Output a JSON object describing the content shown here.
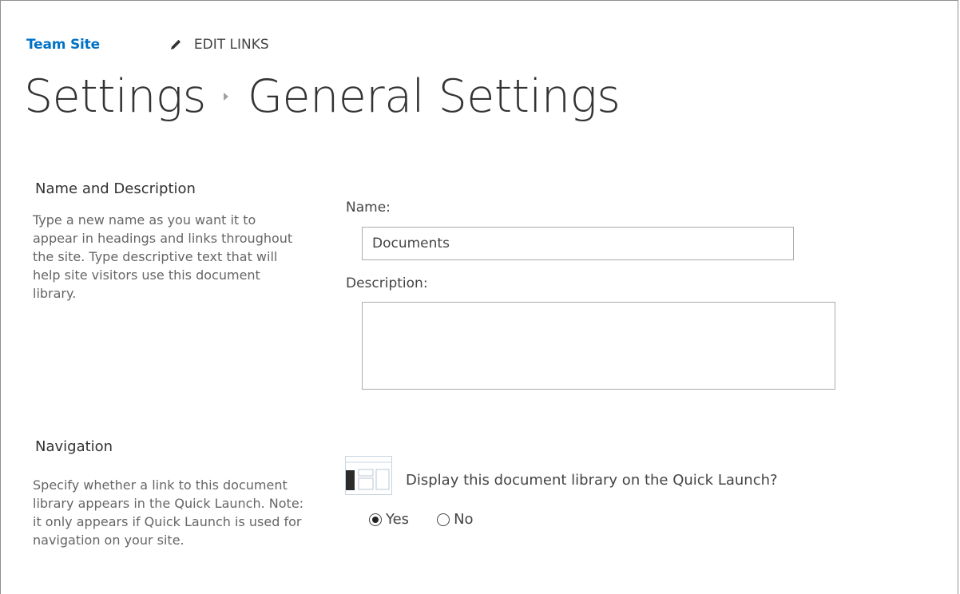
{
  "topnav": {
    "site_name": "Team Site",
    "edit_links_label": "EDIT LINKS"
  },
  "title": {
    "parent": "Settings",
    "current": "General Settings"
  },
  "name_section": {
    "heading": "Name and Description",
    "description": "Type a new name as you want it to appear in headings and links throughout the site. Type descriptive text that will help site visitors use this document library.",
    "name_label": "Name:",
    "name_value": "Documents",
    "description_label": "Description:",
    "description_value": ""
  },
  "navigation_section": {
    "heading": "Navigation",
    "description": "Specify whether a link to this document library appears in the Quick Launch. Note: it only appears if Quick Launch is used for navigation on your site.",
    "question": "Display this document library on the Quick Launch?",
    "options": [
      {
        "label": "Yes",
        "selected": true
      },
      {
        "label": "No",
        "selected": false
      }
    ]
  },
  "icons": [
    "pencil-icon",
    "breadcrumb-arrow-icon",
    "quick-launch-icon"
  ]
}
